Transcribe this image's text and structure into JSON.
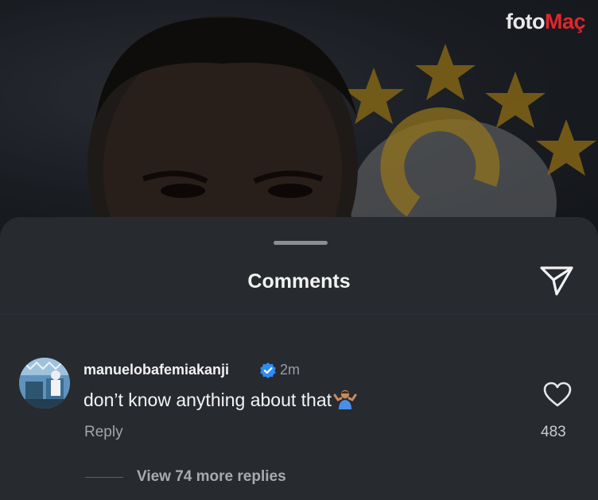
{
  "watermark": {
    "text_main": "foto",
    "text_accent": "Maç"
  },
  "sheet": {
    "title": "Comments"
  },
  "comment": {
    "username": "manuelobafemiakanji",
    "time": "2m",
    "text": "don’t know anything about that",
    "emoji": "person-shrugging-emoji",
    "reply_label": "Reply",
    "like_count": "483"
  },
  "replies": {
    "label": "View 74 more replies"
  },
  "colors": {
    "sheet_bg": "#272a2f",
    "verified_blue": "#2f8cf4",
    "star_yellow": "#d9a321"
  }
}
